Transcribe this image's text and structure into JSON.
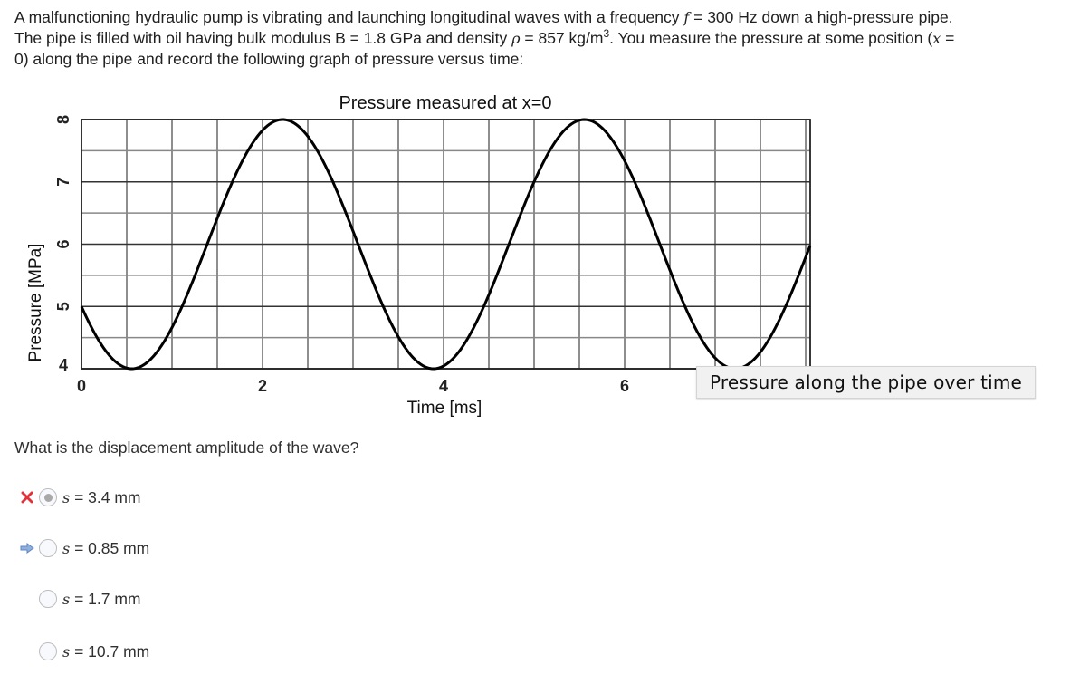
{
  "question": {
    "line1_a": "A malfunctioning hydraulic pump is vibrating and launching longitudinal waves with a frequency ",
    "line1_var": "f",
    "line1_b": " = 300 Hz down a high-pressure pipe.",
    "line2_a": "The pipe is filled with oil having bulk modulus B = 1.8 GPa and density ",
    "line2_var": "ρ",
    "line2_b": " = 857 kg/m",
    "line2_sup": "3",
    "line2_c": ". You measure the pressure at some position (",
    "line2_var2": "x",
    "line2_d": " =",
    "line3": "0) along the pipe and record the following graph of pressure versus time:"
  },
  "chart_data": {
    "type": "line",
    "title": "Pressure measured at x=0",
    "xlabel": "Time [ms]",
    "ylabel": "Pressure [MPa]",
    "xlim": [
      0,
      8.05
    ],
    "ylim": [
      4,
      8
    ],
    "x_ticks": [
      0,
      2,
      4,
      6
    ],
    "x_tick_labels": [
      "0",
      "2",
      "4",
      "6"
    ],
    "y_ticks": [
      4,
      5,
      6,
      7,
      8
    ],
    "y_tick_labels": [
      "4",
      "5",
      "6",
      "7",
      "8"
    ],
    "grid": true,
    "grid_x_step": 0.5,
    "grid_y_step": 0.5,
    "series": [
      {
        "name": "pressure",
        "function": "p(t) = 6 + 2*cos(2*pi*0.3*t + 2*pi/3)",
        "mean": 6,
        "amplitude": 2,
        "frequency_khz": 0.3,
        "phase_rad": 2.0944,
        "x": [
          0,
          0.556,
          1.389,
          2.222,
          3.056,
          3.889,
          4.722,
          5.556,
          6.389,
          7.222,
          8.05
        ],
        "y": [
          5,
          4,
          6,
          8,
          6,
          4,
          6,
          8,
          6,
          4,
          5.97
        ]
      }
    ]
  },
  "tooltip": "Pressure along the pipe over time",
  "subquestion": "What is the displacement amplitude of the wave?",
  "choices": [
    {
      "var": "s",
      "text": " = 3.4 mm",
      "selected": true,
      "status": "incorrect"
    },
    {
      "var": "s",
      "text": " = 0.85 mm",
      "selected": false,
      "status": "correct-answer"
    },
    {
      "var": "s",
      "text": " = 1.7 mm",
      "selected": false,
      "status": "none"
    },
    {
      "var": "s",
      "text": " = 10.7 mm",
      "selected": false,
      "status": "none"
    }
  ],
  "colors": {
    "incorrect": "#e0323a",
    "correct_arrow": "#7fa3d6",
    "curve": "#000000",
    "grid": "#333333"
  }
}
